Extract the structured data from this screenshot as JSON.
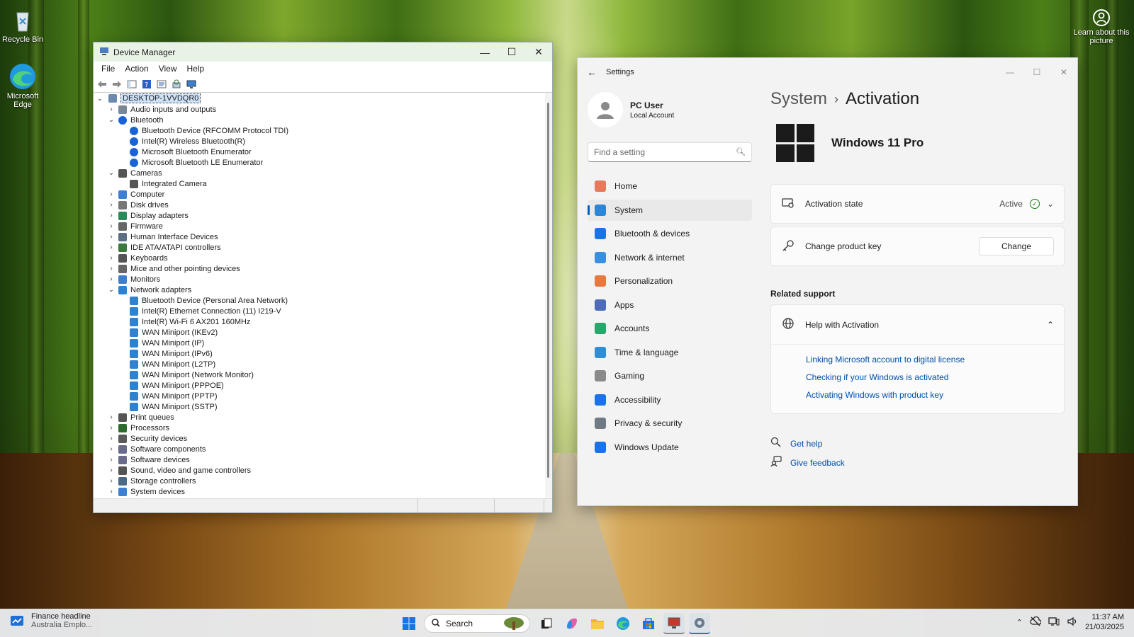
{
  "desktop": {
    "icons": [
      {
        "label": "Recycle Bin",
        "icon": "recycle-bin-icon"
      },
      {
        "label": "Microsoft Edge",
        "icon": "edge-icon"
      }
    ],
    "spotlight_label": "Learn about this picture"
  },
  "device_manager": {
    "title": "Device Manager",
    "menu": [
      "File",
      "Action",
      "View",
      "Help"
    ],
    "root": "DESKTOP-1VVDQR0",
    "tree": [
      {
        "label": "Audio inputs and outputs",
        "expanded": false,
        "level": 1,
        "icon": "audio-icon"
      },
      {
        "label": "Bluetooth",
        "expanded": true,
        "level": 1,
        "icon": "bluetooth-icon"
      },
      {
        "label": "Bluetooth Device (RFCOMM Protocol TDI)",
        "level": 2,
        "icon": "bluetooth-icon"
      },
      {
        "label": "Intel(R) Wireless Bluetooth(R)",
        "level": 2,
        "icon": "bluetooth-icon"
      },
      {
        "label": "Microsoft Bluetooth Enumerator",
        "level": 2,
        "icon": "bluetooth-icon"
      },
      {
        "label": "Microsoft Bluetooth LE Enumerator",
        "level": 2,
        "icon": "bluetooth-icon"
      },
      {
        "label": "Cameras",
        "expanded": true,
        "level": 1,
        "icon": "camera-icon"
      },
      {
        "label": "Integrated Camera",
        "level": 2,
        "icon": "camera-icon"
      },
      {
        "label": "Computer",
        "expanded": false,
        "level": 1,
        "icon": "computer-icon"
      },
      {
        "label": "Disk drives",
        "expanded": false,
        "level": 1,
        "icon": "disk-icon"
      },
      {
        "label": "Display adapters",
        "expanded": false,
        "level": 1,
        "icon": "display-icon"
      },
      {
        "label": "Firmware",
        "expanded": false,
        "level": 1,
        "icon": "firmware-icon"
      },
      {
        "label": "Human Interface Devices",
        "expanded": false,
        "level": 1,
        "icon": "hid-icon"
      },
      {
        "label": "IDE ATA/ATAPI controllers",
        "expanded": false,
        "level": 1,
        "icon": "ide-icon"
      },
      {
        "label": "Keyboards",
        "expanded": false,
        "level": 1,
        "icon": "keyboard-icon"
      },
      {
        "label": "Mice and other pointing devices",
        "expanded": false,
        "level": 1,
        "icon": "mouse-icon"
      },
      {
        "label": "Monitors",
        "expanded": false,
        "level": 1,
        "icon": "monitor-icon"
      },
      {
        "label": "Network adapters",
        "expanded": true,
        "level": 1,
        "icon": "network-icon"
      },
      {
        "label": "Bluetooth Device (Personal Area Network)",
        "level": 2,
        "icon": "network-icon"
      },
      {
        "label": "Intel(R) Ethernet Connection (11) I219-V",
        "level": 2,
        "icon": "network-icon"
      },
      {
        "label": "Intel(R) Wi-Fi 6 AX201 160MHz",
        "level": 2,
        "icon": "network-icon"
      },
      {
        "label": "WAN Miniport (IKEv2)",
        "level": 2,
        "icon": "network-icon"
      },
      {
        "label": "WAN Miniport (IP)",
        "level": 2,
        "icon": "network-icon"
      },
      {
        "label": "WAN Miniport (IPv6)",
        "level": 2,
        "icon": "network-icon"
      },
      {
        "label": "WAN Miniport (L2TP)",
        "level": 2,
        "icon": "network-icon"
      },
      {
        "label": "WAN Miniport (Network Monitor)",
        "level": 2,
        "icon": "network-icon"
      },
      {
        "label": "WAN Miniport (PPPOE)",
        "level": 2,
        "icon": "network-icon"
      },
      {
        "label": "WAN Miniport (PPTP)",
        "level": 2,
        "icon": "network-icon"
      },
      {
        "label": "WAN Miniport (SSTP)",
        "level": 2,
        "icon": "network-icon"
      },
      {
        "label": "Print queues",
        "expanded": false,
        "level": 1,
        "icon": "printer-icon"
      },
      {
        "label": "Processors",
        "expanded": false,
        "level": 1,
        "icon": "processor-icon"
      },
      {
        "label": "Security devices",
        "expanded": false,
        "level": 1,
        "icon": "security-device-icon"
      },
      {
        "label": "Software components",
        "expanded": false,
        "level": 1,
        "icon": "software-component-icon"
      },
      {
        "label": "Software devices",
        "expanded": false,
        "level": 1,
        "icon": "software-device-icon"
      },
      {
        "label": "Sound, video and game controllers",
        "expanded": false,
        "level": 1,
        "icon": "sound-icon"
      },
      {
        "label": "Storage controllers",
        "expanded": false,
        "level": 1,
        "icon": "storage-icon"
      },
      {
        "label": "System devices",
        "expanded": false,
        "level": 1,
        "icon": "system-device-icon"
      }
    ]
  },
  "settings": {
    "title": "Settings",
    "user": {
      "name": "PC User",
      "account": "Local Account"
    },
    "search_placeholder": "Find a setting",
    "nav": [
      {
        "label": "Home",
        "icon": "home-icon",
        "color": "#e8795b"
      },
      {
        "label": "System",
        "icon": "system-icon",
        "color": "#2b86d8",
        "selected": true
      },
      {
        "label": "Bluetooth & devices",
        "icon": "bluetooth-icon",
        "color": "#1a73e8"
      },
      {
        "label": "Network & internet",
        "icon": "wifi-icon",
        "color": "#3b8fe0"
      },
      {
        "label": "Personalization",
        "icon": "brush-icon",
        "color": "#e8793e"
      },
      {
        "label": "Apps",
        "icon": "apps-icon",
        "color": "#4d6bb8"
      },
      {
        "label": "Accounts",
        "icon": "accounts-icon",
        "color": "#27a86b"
      },
      {
        "label": "Time & language",
        "icon": "globe-clock-icon",
        "color": "#2f8fd6"
      },
      {
        "label": "Gaming",
        "icon": "gamepad-icon",
        "color": "#8a8a8a"
      },
      {
        "label": "Accessibility",
        "icon": "accessibility-icon",
        "color": "#1a73e8"
      },
      {
        "label": "Privacy & security",
        "icon": "shield-icon",
        "color": "#707a85"
      },
      {
        "label": "Windows Update",
        "icon": "update-icon",
        "color": "#1a73e8"
      }
    ],
    "breadcrumb": {
      "parent": "System",
      "current": "Activation"
    },
    "product_name": "Windows 11 Pro",
    "activation_state": {
      "label": "Activation state",
      "value": "Active"
    },
    "product_key": {
      "label": "Change product key",
      "button": "Change"
    },
    "related_support": "Related support",
    "help": {
      "label": "Help with Activation",
      "links": [
        "Linking Microsoft account to digital license",
        "Checking if your Windows is activated",
        "Activating Windows with product key"
      ]
    },
    "get_help": "Get help",
    "give_feedback": "Give feedback"
  },
  "taskbar": {
    "widget": {
      "title": "Finance headline",
      "subtitle": "Australia Emplo..."
    },
    "search": "Search",
    "time": "11:37 AM",
    "date": "21/03/2025"
  }
}
